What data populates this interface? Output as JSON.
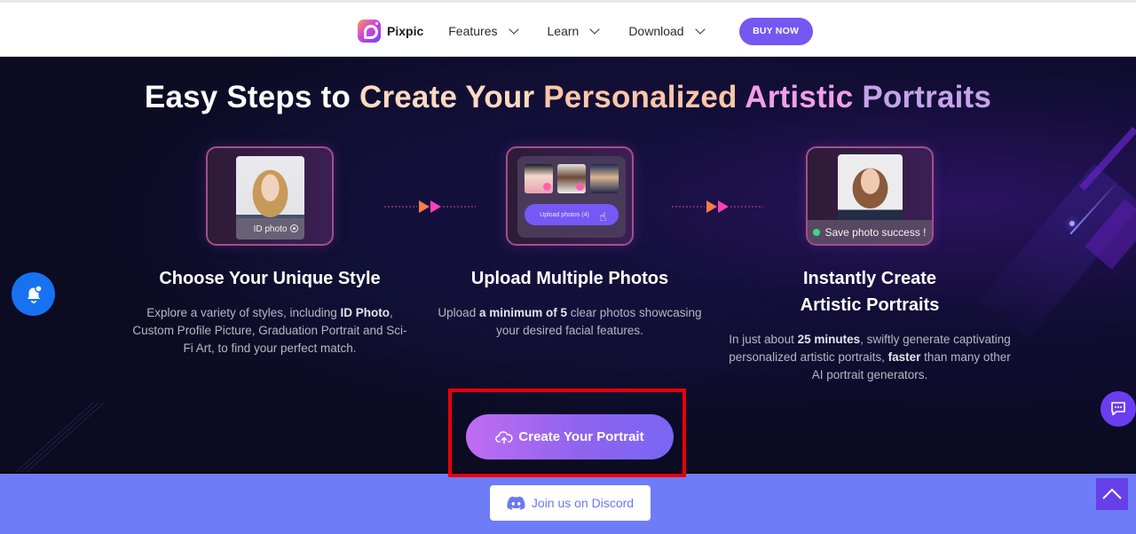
{
  "nav": {
    "brand": "Pixpic",
    "items": [
      {
        "label": "Features",
        "icon": "chevron-down-icon"
      },
      {
        "label": "Learn",
        "icon": "chevron-down-icon"
      },
      {
        "label": "Download",
        "icon": "chevron-down-icon"
      }
    ],
    "buy_label": "BUY NOW"
  },
  "hero": {
    "title_parts": [
      "Easy Steps to ",
      "Create Your ",
      "Personalized ",
      "Artistic ",
      "Portraits"
    ],
    "steps": [
      {
        "title": "Choose Your Unique Style",
        "desc_parts": [
          "Explore a variety of styles, including ",
          "ID Photo",
          ", Custom Profile Picture, Graduation Portrait and Sci-Fi Art, to find your perfect match."
        ],
        "card_label": "ID photo"
      },
      {
        "title": "Upload Multiple Photos",
        "desc_parts": [
          "Upload ",
          "a minimum of 5",
          " clear photos showcasing your desired facial features."
        ],
        "card_label": "Upload photos (4)"
      },
      {
        "title": "Instantly Create Artistic Portraits",
        "desc_parts": [
          "In just about ",
          "25 minutes",
          ", swiftly generate captivating personalized artistic portraits, ",
          "faster",
          " than many other AI portrait generators."
        ],
        "card_label": "Save photo success !"
      }
    ],
    "cta_label": "Create Your Portrait"
  },
  "footer": {
    "discord_label": "Join us on Discord"
  },
  "colors": {
    "brand_purple": "#7558f2",
    "hero_bg": "#0b0b22",
    "band": "#6f7cf8",
    "highlight_box": "#e8000b",
    "notification_blue": "#1672f0"
  }
}
